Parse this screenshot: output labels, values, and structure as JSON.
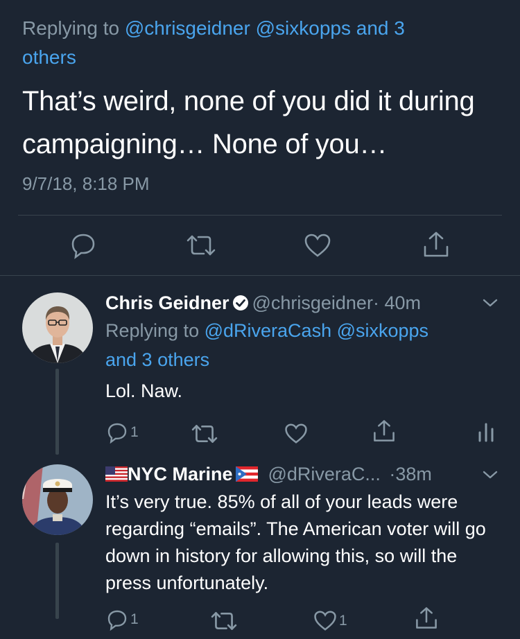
{
  "main_tweet": {
    "replying_prefix": "Replying to",
    "replying_mentions": "@chrisgeidner @sixkopps and 3",
    "replying_tail": "others",
    "text": "That’s weird, none of you did it during campaigning… None of you…",
    "timestamp": "9/7/18, 8:18 PM"
  },
  "replies": [
    {
      "name": "Chris Geidner",
      "handle": "@chrisgeidner",
      "time": "· 40m",
      "replying_prefix": "Replying to",
      "replying_mentions": "@dRiveraCash @sixkopps",
      "replying_tail": "and 3 others",
      "text": "Lol. Naw.",
      "reply_count": "1",
      "like_count": ""
    },
    {
      "name": "NYC Marine",
      "handle": "@dRiveraC...",
      "time": "·38m",
      "text": "It’s very true. 85% of all of your leads were regarding “emails”. The American voter will go down in history for allowing this, so will the press unfortunately.",
      "reply_count": "1",
      "like_count": "1"
    }
  ],
  "colors": {
    "background": "#1c2532",
    "link": "#4aa5ee",
    "muted": "#8899a6",
    "divider": "#38444d"
  },
  "icons": [
    "reply-icon",
    "retweet-icon",
    "like-icon",
    "share-icon",
    "analytics-icon",
    "verified-badge-icon",
    "chevron-down-icon",
    "us-flag-icon",
    "puerto-rico-flag-icon"
  ]
}
